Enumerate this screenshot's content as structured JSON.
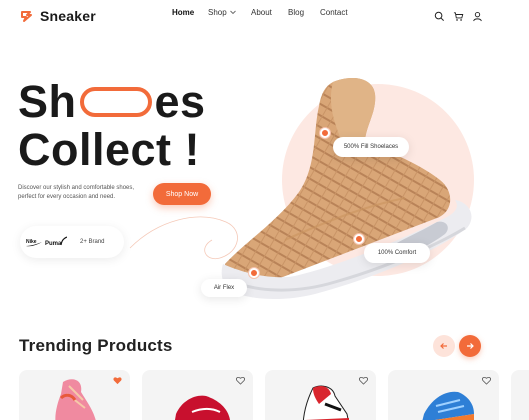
{
  "brand": {
    "name": "Sneaker",
    "accent": "#f26b3a"
  },
  "nav": {
    "items": [
      "Home",
      "Shop",
      "About",
      "Blog",
      "Contact"
    ],
    "active": "Home",
    "icons": [
      "search-icon",
      "cart-icon",
      "user-icon"
    ]
  },
  "hero": {
    "title_part1": "Sh",
    "title_part2": "es",
    "title_line2": "Collect !",
    "description": "Discover our stylish and comfortable shoes, perfect for every occasion and need.",
    "cta": "Shop Now",
    "brands_label": "2+ Brand",
    "brand_logos": [
      "Nike",
      "Puma"
    ],
    "callouts": [
      "500% Fill Shoelaces",
      "100% Comfort",
      "Air Flex"
    ]
  },
  "trending": {
    "title": "Trending Products",
    "products": [
      {
        "color": "#f08aa0",
        "liked": true
      },
      {
        "color": "#c8102e",
        "liked": false
      },
      {
        "color": "#d9262e",
        "liked": false
      },
      {
        "color": "#2e7fd6",
        "liked": false
      }
    ]
  }
}
